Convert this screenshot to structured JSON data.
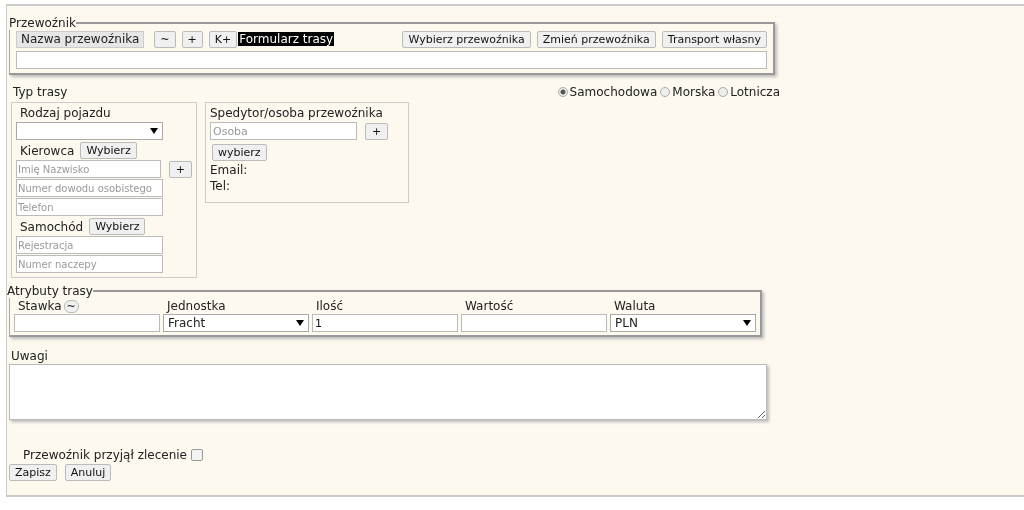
{
  "carrier": {
    "legend": "Przewoźnik",
    "name_label": "Nazwa przewoźnika",
    "tool_buttons": [
      "~",
      "+",
      "K+"
    ],
    "highlight": "Formularz trasy",
    "action_buttons": [
      "Wybierz przewoźnika",
      "Zmień przewoźnika",
      "Transport własny"
    ]
  },
  "route_type": {
    "label": "Typ trasy",
    "options": [
      {
        "label": "Samochodowa",
        "selected": true
      },
      {
        "label": "Morska",
        "selected": false
      },
      {
        "label": "Lotnicza",
        "selected": false
      }
    ]
  },
  "vehicle": {
    "title": "Rodzaj pojazdu",
    "driver": {
      "label": "Kierowca",
      "button": "Wybierz",
      "add": "+",
      "fields": [
        {
          "placeholder": "Imię Nazwisko"
        },
        {
          "placeholder": "Numer dowodu osobistego"
        },
        {
          "placeholder": "Telefon"
        }
      ]
    },
    "car": {
      "label": "Samochód",
      "button": "Wybierz",
      "fields": [
        {
          "placeholder": "Rejestracja"
        },
        {
          "placeholder": "Numer naczepy"
        }
      ]
    }
  },
  "forwarder": {
    "title": "Spedytor/osoba przewoźnika",
    "placeholder": "Osoba",
    "add": "+",
    "button": "wybierz",
    "lines": [
      "Email:",
      "Tel:"
    ]
  },
  "attributes": {
    "legend": "Atrybuty trasy",
    "columns": [
      {
        "label": "Stawka",
        "kind": "input",
        "button": "~"
      },
      {
        "label": "Jednostka",
        "kind": "select",
        "value": "Fracht"
      },
      {
        "label": "Ilość",
        "kind": "input",
        "value": "1"
      },
      {
        "label": "Wartość",
        "kind": "input"
      },
      {
        "label": "Waluta",
        "kind": "select",
        "value": "PLN"
      }
    ]
  },
  "notes": {
    "label": "Uwagi"
  },
  "accepted": {
    "label": "Przewoźnik przyjął zlecenie",
    "checked": false
  },
  "buttons": [
    "Zapisz",
    "Anuluj"
  ]
}
